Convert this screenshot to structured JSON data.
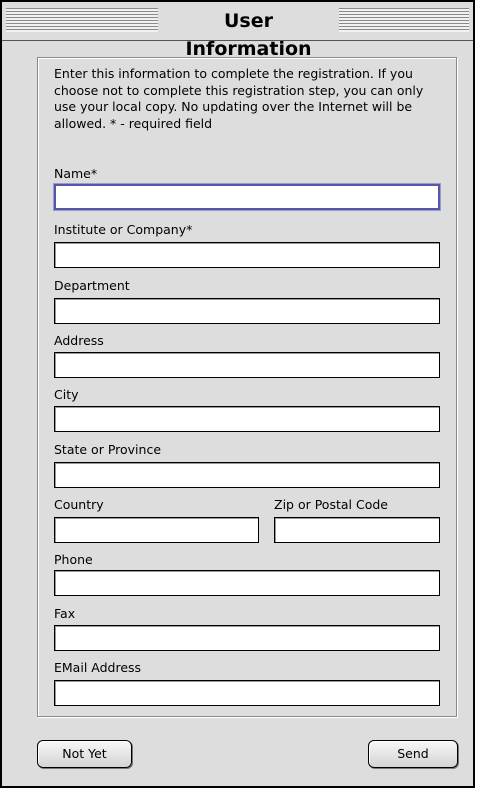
{
  "window": {
    "title": "User Information"
  },
  "intro_text": "Enter this information to complete the registration.  If you choose not to complete this registration step, you can only use your local copy.  No updating over the Internet will be allowed. * - required field",
  "fields": {
    "name": {
      "label": "Name*",
      "value": ""
    },
    "institute": {
      "label": "Institute or Company*",
      "value": ""
    },
    "department": {
      "label": "Department",
      "value": ""
    },
    "address": {
      "label": "Address",
      "value": ""
    },
    "city": {
      "label": "City",
      "value": ""
    },
    "state": {
      "label": "State or Province",
      "value": ""
    },
    "country": {
      "label": "Country",
      "value": ""
    },
    "zip": {
      "label": "Zip or Postal Code",
      "value": ""
    },
    "phone": {
      "label": "Phone",
      "value": ""
    },
    "fax": {
      "label": "Fax",
      "value": ""
    },
    "email": {
      "label": "EMail Address",
      "value": ""
    }
  },
  "buttons": {
    "not_yet": "Not Yet",
    "send": "Send"
  },
  "colors": {
    "window_bg": "#dddddd",
    "focus_ring": "#5458a6"
  }
}
